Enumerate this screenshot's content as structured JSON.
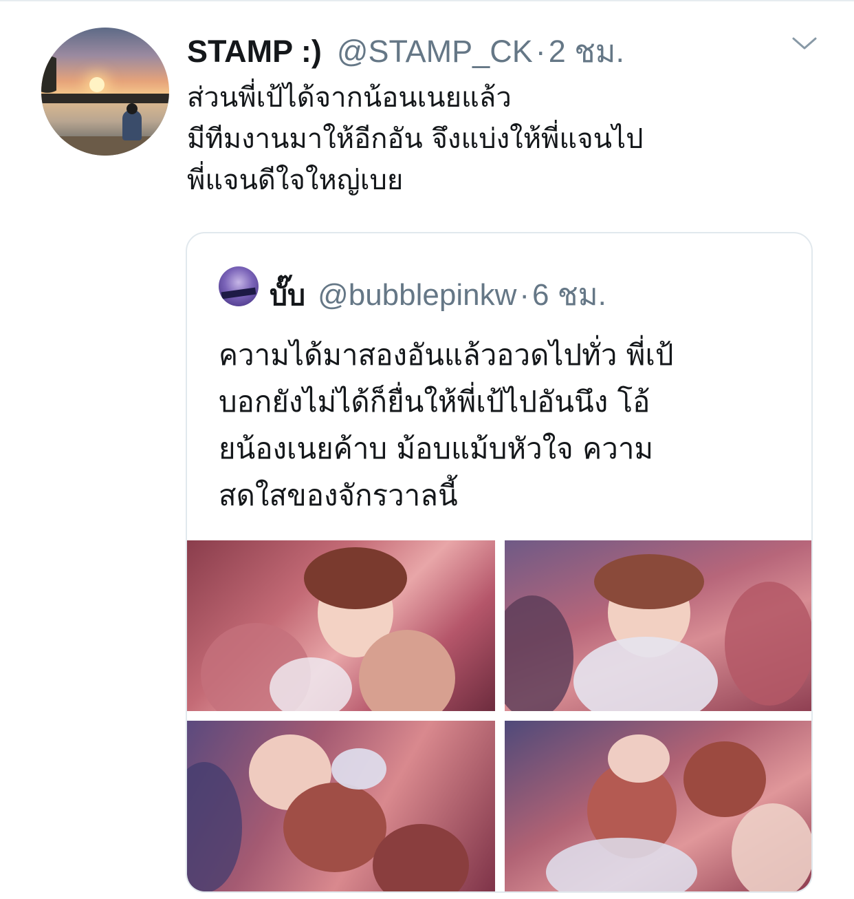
{
  "tweet": {
    "display_name": "STAMP :)",
    "handle": "@STAMP_CK",
    "separator": "·",
    "time": "2 ชม.",
    "text_lines": [
      "ส่วนพี่เป้ได้จากน้อนเนยแล้ว",
      "มีทีมงานมาให้อีกอัน จึงแบ่งให้พี่แจนไป",
      "พี่แจนดีใจใหญ่เบย"
    ],
    "menu_icon": "chevron-down-icon"
  },
  "quoted_tweet": {
    "display_name": "บั๊บ",
    "handle": "@bubblepinkw",
    "separator": "·",
    "time": "6 ชม.",
    "text_lines": [
      "ความได้มาสองอันแล้วอวดไปทั่ว พี่เป้",
      "บอกยังไม่ได้ก็ยื่นให้พี่เป้ไปอันนึง โอ้",
      "ยน้องเนยค้าบ ม้อบแม้บหัวใจ ความ",
      "สดใสของจักรวาลนี้"
    ],
    "media_count": 4
  },
  "colors": {
    "text_primary": "#14171a",
    "text_secondary": "#657786",
    "border": "#e1e8ed"
  }
}
